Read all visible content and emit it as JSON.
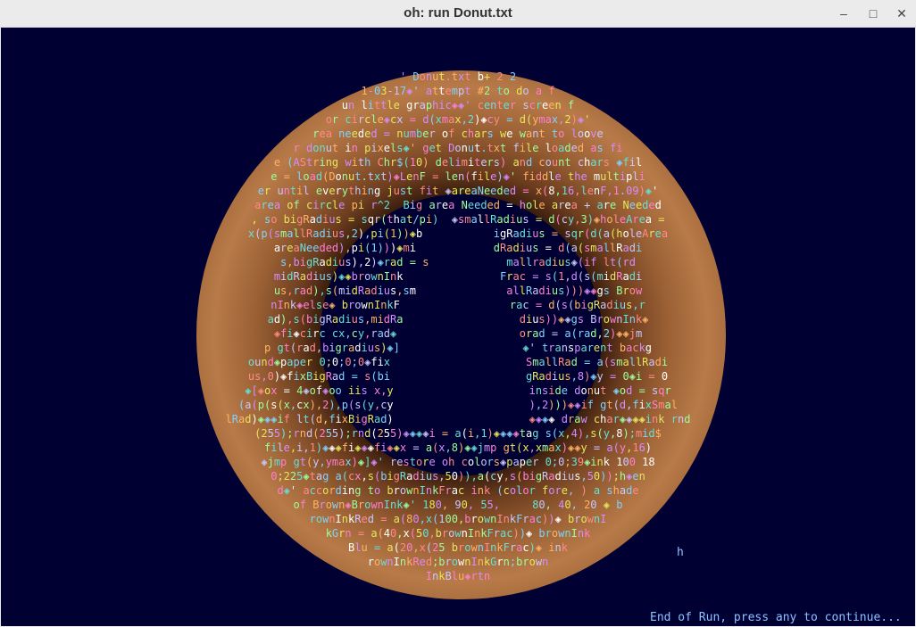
{
  "window": {
    "title": "oh: run Donut.txt",
    "min_icon": "–",
    "max_icon": "□",
    "close_icon": "✕"
  },
  "colors": {
    "canvas_bg": "#000033",
    "donut_dark": "#3a1e0e",
    "donut_light": "#b87a48",
    "status_text": "#8ec2ff",
    "text_palette": [
      "#e6e65c",
      "#7fd3ff",
      "#ff8a8a",
      "#9cff9c",
      "#d58cff",
      "#ffb366",
      "#ffffff",
      "#66e0d6",
      "#ff7fd0",
      "#c8c8ff"
    ]
  },
  "lines": [
    "' Donut.txt b+ 2 2",
    "1-03-17◈' attempt #2 to do a f",
    "un little graphic◈◈' center screen f",
    "or circle◈cx = d(xmax,2)◈cy = d(ymax,2)◈'",
    "rea needed = number of chars we want to loove",
    "r donut in pixels◈' get Donut.txt file loaded as fi",
    "e (AString with Chr$(10) delimiters) and count chars ◈fil",
    "e = load(Donut.txt)◈LenF = len(file)◈' fiddle the multipli",
    "er until everything just fit ◈areaNeeded = x(8,16,lenF,1.09)◈'",
    "area of circle pi r^2  Big area Needed = hole area + are Needed",
    ", so bigRadius = sqr(that/pi)  ◈smallRadius = d(cy,3)◈holeArea =",
    "x(p(smallRadius,2),pi(1))◈b           igRadius = sqr(d(a(holeArea",
    "areaNeeded),pi(1)))◈mi            dRadius = d(a(smallRadi",
    "s,bigRadius),2)◈rad = s            mallradius◈(if lt(rd",
    "midRadius)◈◈brownInk               Frac = s(1,d(s(midRadi",
    "us,rad),s(midRadius,sm              allRadius)))◈◈gs Brow",
    "nInk◈else◈ brownInkF                 rac = d(s(bigRadius,r",
    "ad),s(bigRadius,midRa                  dius))◈◈gs BrownInk◈",
    "◈fi◈circ cx,cy,rad◈                   orad = a(rad,2)◈◈jm",
    "p gt(rad,bigradius)◈]                   ◈' transparent backg",
    "ound◈paper 0;0;0;0◈fix                     SmallRad = a(smallRadi",
    "us,0)◈fixBigRad = s(bi                     gRadius,8)◈y = 0◈i = 0",
    "◈[◈ox = 4◈of◈oo iis x,y                     inside donut ◈od = sqr",
    "(a(p(s(x,cx),2),p(s(y,cy                     ),2)))◈◈if gt(d,fixSmal",
    "lRad)◈◈◈if lt(d,fixBigRad)                     ◈◈◈◈ draw char◈◈◈◈ink rnd",
    "(255);rnd(255);rnd(255)◈◈◈◈i = a(i,1)◈◈◈◈tag s(x,4),s(y,8);mid$",
    "file,i,1)◈◈◈fi◈◈◈fi◈◈x = a(x,8)◈◈jmp gt(x,xmax)◈◈y = a(y,16)",
    "◈jmp gt(y,ymax)◈]◈' restore oh colors◈paper 0;0;39◈ink 100 18",
    "0;225◈tag a(cx,s(bigRadius,50)),a(cy,s(bigRadius,50));h◈en",
    "d◈' according to brownInkFrac ink (color fore, ) a shade",
    "of Brown◈BrownInk◈' 180, 90, 55,     80, 40, 20 ◈ b",
    "rownInkRed = a(80,x(100,brownInkFrac))◈ brownI",
    "kGrn = a(40,x(50,brownInkFrac))◈ brownInk",
    "Blu = a(20,x(25 brownInkFrac)◈ ink",
    "rownInkRed;brownInkGrn;brown",
    "InkBlu◈rtn"
  ],
  "stray_char": "h",
  "status": "End of Run, press any to continue..."
}
